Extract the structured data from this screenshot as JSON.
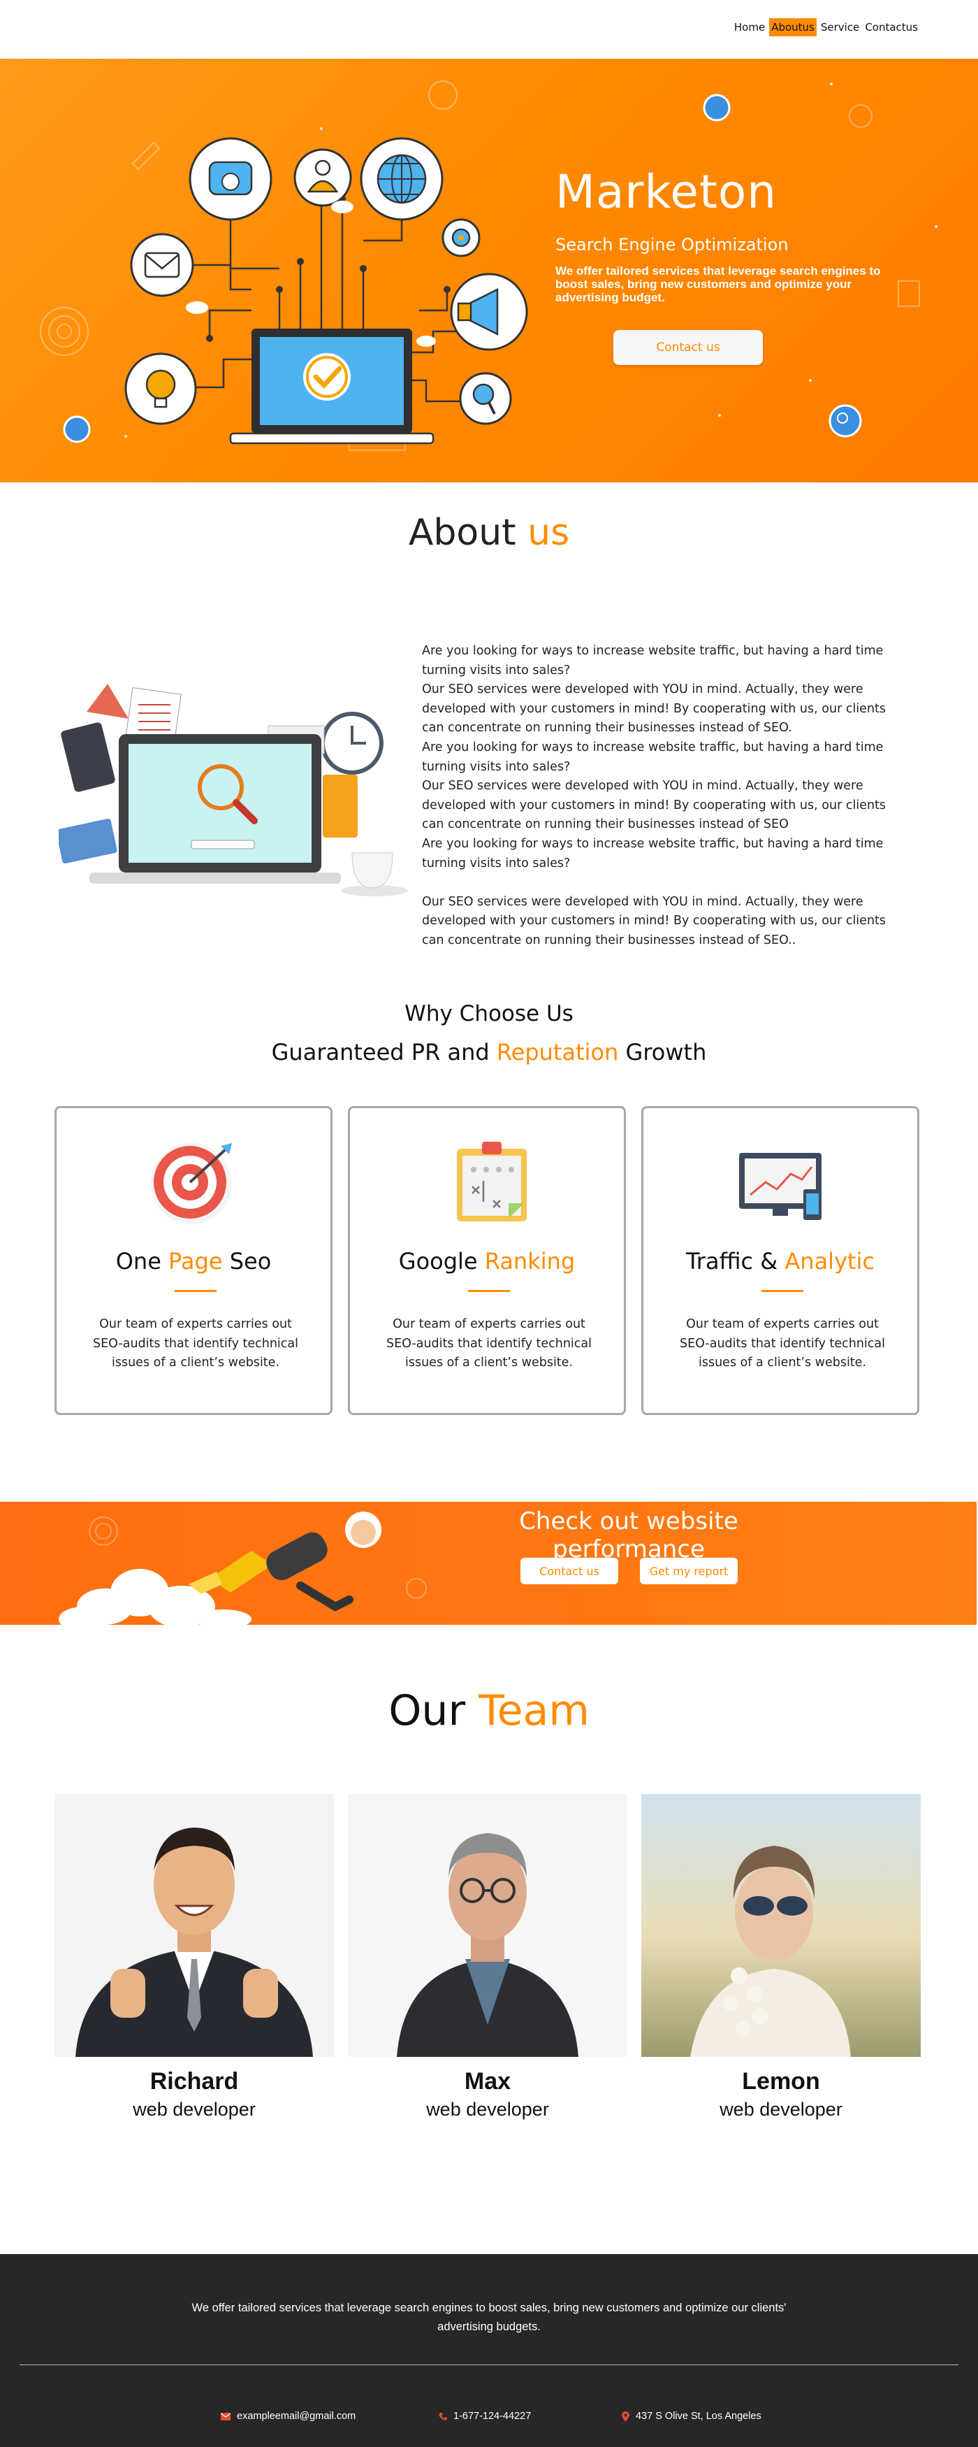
{
  "nav": {
    "items": [
      {
        "label": "Home"
      },
      {
        "label": "Aboutus"
      },
      {
        "label": "Service"
      },
      {
        "label": "Contactus"
      }
    ],
    "active": "Aboutus"
  },
  "hero": {
    "title": "Marketon",
    "subtitle": "Search Engine Optimization",
    "text": "We offer tailored services that leverage search engines to boost sales, bring new customers and optimize your advertising budget.",
    "button": "Contact us"
  },
  "about": {
    "title_main": "About",
    "title_accent": "us",
    "paragraphs": [
      "Are you looking for ways to increase website traffic, but having a hard time turning visits into sales?",
      "Our SEO services were developed with YOU in mind. Actually, they were developed with your customers in mind! By cooperating with us, our clients can concentrate on running their businesses instead of SEO.",
      "Are you looking for ways to increase website traffic, but having a hard time turning visits into sales?",
      "Our SEO services were developed with YOU in mind. Actually, they were developed with your customers in mind! By cooperating with us, our clients can concentrate on running their businesses instead of SEO",
      "Are you looking for ways to increase website traffic, but having a hard time turning visits into sales?",
      "Our SEO services were developed with YOU in mind. Actually, they were developed with your customers in mind! By cooperating with us, our clients can concentrate on running their businesses instead of SEO.."
    ]
  },
  "why": {
    "title": "Why Choose Us",
    "subtitle_pre": "Guaranteed PR and ",
    "subtitle_accent": "Reputation",
    "subtitle_post": " Growth",
    "cards": [
      {
        "icon": "target-icon",
        "title_pre": "One ",
        "title_accent": "Page",
        "title_post": " Seo",
        "text": "Our team of experts carries out SEO-audits that identify technical issues of a client’s website."
      },
      {
        "icon": "clipboard-icon",
        "title_pre": "Google ",
        "title_accent": "Ranking",
        "title_post": "",
        "text": "Our team of experts carries out SEO-audits that identify technical issues of a client’s website."
      },
      {
        "icon": "analytics-icon",
        "title_pre": "Traffic & ",
        "title_accent": "Analytic",
        "title_post": "",
        "text": "Our team of experts carries out SEO-audits that identify technical issues of a client’s website."
      }
    ]
  },
  "performance": {
    "title": "Check out website performance",
    "button_contact": "Contact us",
    "button_report": "Get my report"
  },
  "team": {
    "title_main": "Our",
    "title_accent": "Team",
    "members": [
      {
        "name": "Richard",
        "role": "web developer"
      },
      {
        "name": "Max",
        "role": "web developer"
      },
      {
        "name": "Lemon",
        "role": "web developer"
      }
    ]
  },
  "footer": {
    "text": "We offer tailored services that leverage search engines to boost sales, bring new customers and optimize our clients' advertising budgets.",
    "email": "exampleemail@gmail.com",
    "phone": "1-677-124-44227",
    "address": "437 S Olive St, Los Angeles"
  },
  "colors": {
    "accent": "#ff8b00",
    "hero_bg": "#ff8a00",
    "footer_bg": "#272727"
  }
}
